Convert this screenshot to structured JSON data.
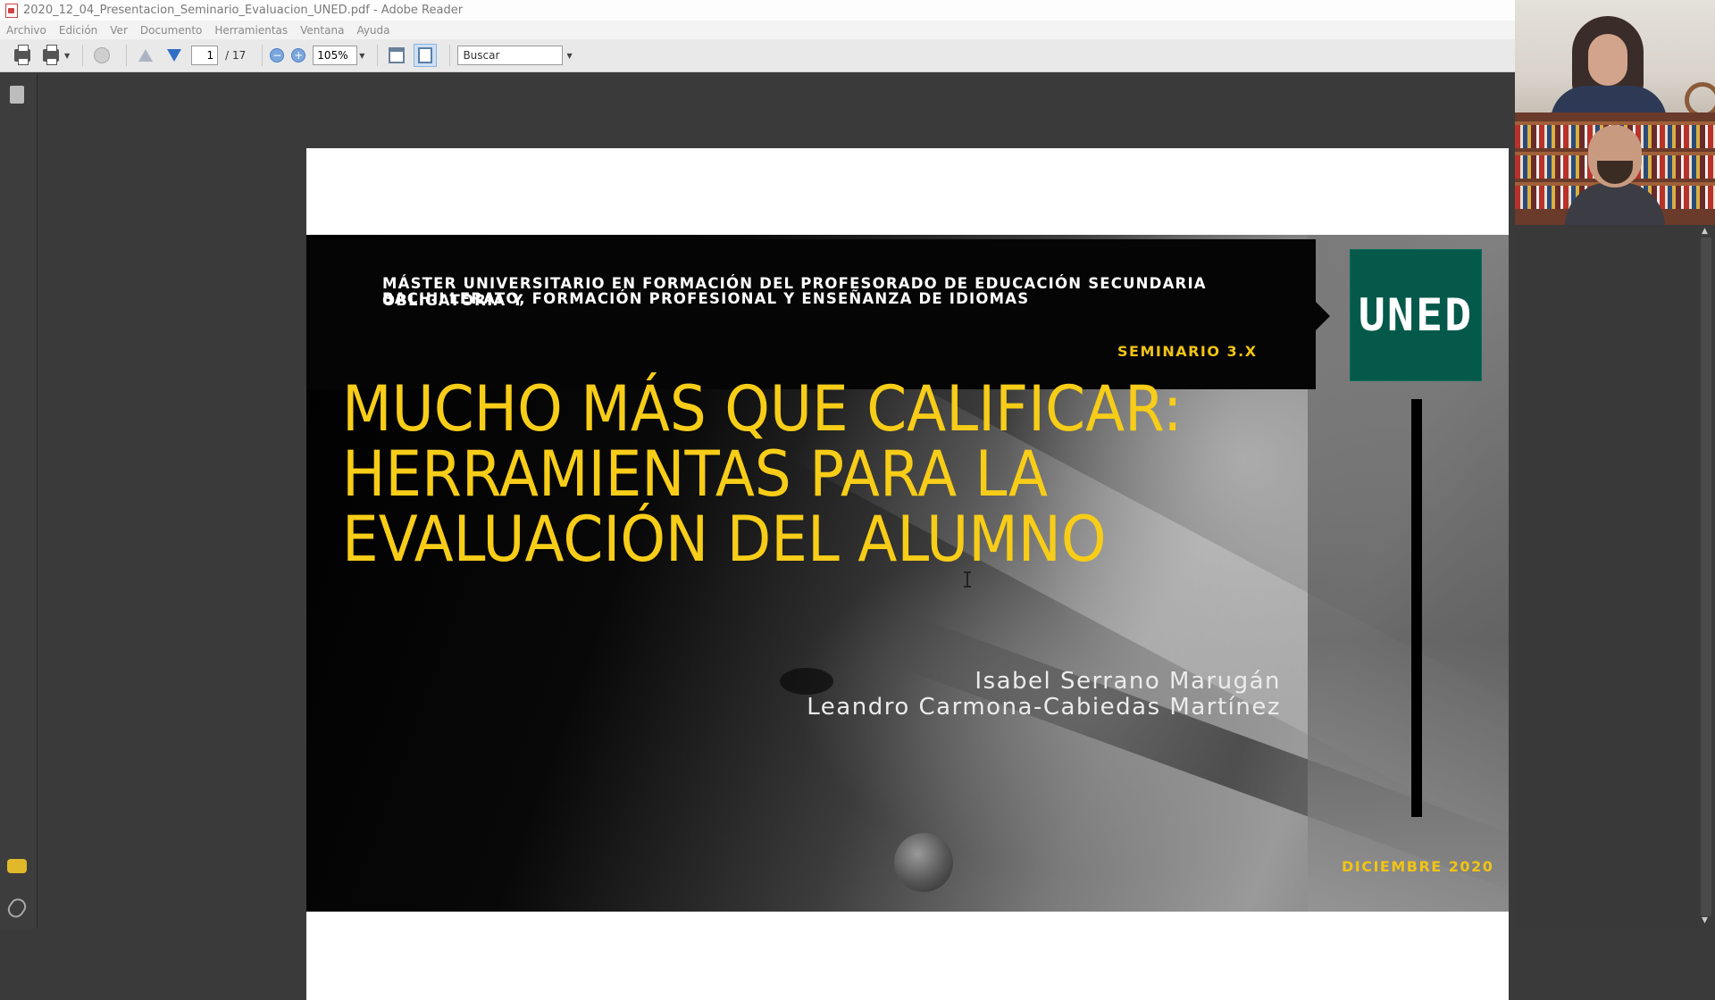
{
  "window": {
    "title": "2020_12_04_Presentacion_Seminario_Evaluacion_UNED.pdf - Adobe Reader"
  },
  "menu": [
    "Archivo",
    "Edición",
    "Ver",
    "Documento",
    "Herramientas",
    "Ventana",
    "Ayuda"
  ],
  "toolbar": {
    "current_page": "1",
    "total_pages": "/ 17",
    "zoom_minus": "−",
    "zoom_plus": "+",
    "zoom": "105%",
    "search_placeholder": "Buscar"
  },
  "slide": {
    "header_line1": "MÁSTER UNIVERSITARIO EN FORMACIÓN DEL PROFESORADO DE EDUCACIÓN SECUNDARIA OBLIGATORIA Y",
    "header_line2": "BACHILLERATO, FORMACIÓN PROFESIONAL Y ENSEÑANZA DE IDIOMAS",
    "seminar": "SEMINARIO 3.X",
    "logo": "UNED",
    "title_line1": "MUCHO MÁS QUE CALIFICAR:",
    "title_line2": "HERRAMIENTAS PARA LA",
    "title_line3": "EVALUACIÓN DEL ALUMNO",
    "author1": "Isabel Serrano Marugán",
    "author2": "Leandro Carmona-Cabiedas Martínez",
    "date": "DICIEMBRE 2020"
  },
  "colors": {
    "title_yellow": "#f7cd18",
    "accent_yellow": "#f2c414",
    "uned_green": "#04594a"
  }
}
